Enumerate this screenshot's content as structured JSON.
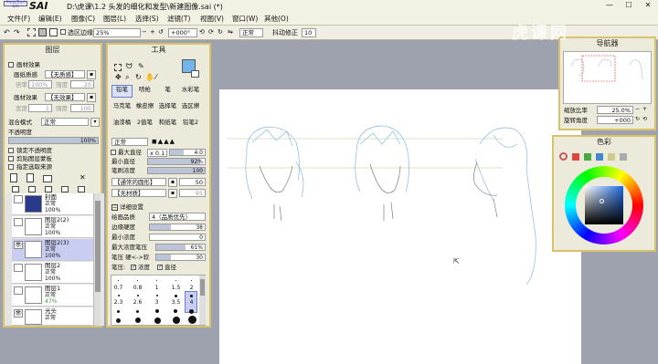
{
  "window": {
    "logo": "PaintTool SAI",
    "title": "D:\\虎课\\1.2 头发的细化和发型\\新建图像.sai (*)",
    "controls": [
      "—",
      "☐",
      "✕"
    ]
  },
  "menu": [
    "文件(F)",
    "编辑(E)",
    "图像(C)",
    "图层(L)",
    "选择(S)",
    "滤镜(T)",
    "视图(V)",
    "窗口(W)",
    "其他(O)"
  ],
  "toolbar": {
    "selection_edge_label": "选区边缘",
    "zoom": "25%",
    "rotation": "+000°",
    "blend": "正常",
    "stabilizer_label": "抖动修正",
    "stabilizer_value": "10"
  },
  "watermark": "虎课网",
  "layers_panel": {
    "title": "图层",
    "paper_effect_label": "画材效果",
    "texture_label": "画纸质感",
    "texture_value": "【无质感】",
    "scale_label": "倍率",
    "scale_value": "100%",
    "strength_label": "强度",
    "strength_value": "20",
    "effect_label": "画材效果",
    "effect_value": "【无效果】",
    "width_label": "宽度",
    "width_value": "1",
    "effect_strength_value": "100",
    "blend_label": "混合模式",
    "blend_value": "正常",
    "opacity_label": "不透明度",
    "opacity_value": "100%",
    "opacity": 1.0,
    "lock_opacity": "锁定不透明度",
    "clipping": "剪贴图层蒙板",
    "reference": "指定选取来源",
    "layers": [
      {
        "name": "封面",
        "mode": "正常",
        "opacity": "100%",
        "selected": false,
        "visible": false
      },
      {
        "name": "图层2(2)",
        "mode": "正常",
        "opacity": "100%",
        "selected": false,
        "visible": false
      },
      {
        "name": "图层2(3)",
        "mode": "正常",
        "opacity": "100%",
        "selected": true,
        "visible": true
      },
      {
        "name": "图层2",
        "mode": "正常",
        "opacity": "100%",
        "selected": false,
        "visible": false
      },
      {
        "name": "图层1",
        "mode": "正常",
        "opacity": "47%",
        "selected": false,
        "visible": false
      },
      {
        "name": "光头",
        "mode": "正常",
        "opacity": "",
        "selected": false,
        "visible": true
      }
    ]
  },
  "tools_panel": {
    "title": "工具",
    "primary_color": "#74b4e8",
    "brushes": [
      [
        "铅笔",
        "喷枪",
        "笔",
        "水彩笔"
      ],
      [
        "马克笔",
        "橡皮擦",
        "选择笔",
        "选区擦"
      ],
      [
        "油漆桶",
        "2值笔",
        "和纸笔",
        "铅笔2"
      ]
    ],
    "blend_mode": "正常",
    "max_size_label": "最大直径",
    "max_size_mult": "x 0.1",
    "max_size_value": "4.0",
    "min_size_label": "最小直径",
    "min_size_value": "92%",
    "min_size": 0.92,
    "density_label": "笔刷浓度",
    "density_value": "100",
    "density": 1.0,
    "shape_value": "【通常的圆形】",
    "shape_num": "50",
    "texture_value": "【无材质】",
    "texture_num": "95",
    "detail_label": "详细设置",
    "quality_label": "绘画品质",
    "quality_value": "4（品质优先）",
    "edge_label": "边缘硬度",
    "edge_value": "38",
    "edge": 0.38,
    "min_density_label": "最小浓度",
    "min_density_value": "0",
    "min_density": 0.0,
    "max_pressure_label": "最大浓度笔压",
    "max_pressure_value": "61%",
    "max_pressure": 0.61,
    "pressure_hard_label": "笔压 硬<->软",
    "pressure_hard_value": "30",
    "pressure_hard": 0.3,
    "pressure_label": "笔压:",
    "pressure_density": "浓度",
    "pressure_size": "直径",
    "size_labels": [
      "0.7",
      "0.8",
      "1",
      "1.5",
      "2",
      "2.3",
      "2.6",
      "3",
      "3.5",
      "4"
    ],
    "selected_size": "4"
  },
  "navigator": {
    "title": "导航器",
    "zoom_label": "缩放比率",
    "zoom_value": "25.0%",
    "angle_label": "旋转角度",
    "angle_value": "+000"
  },
  "color_panel": {
    "title": "色彩",
    "square_color": "#1f6ae0"
  }
}
